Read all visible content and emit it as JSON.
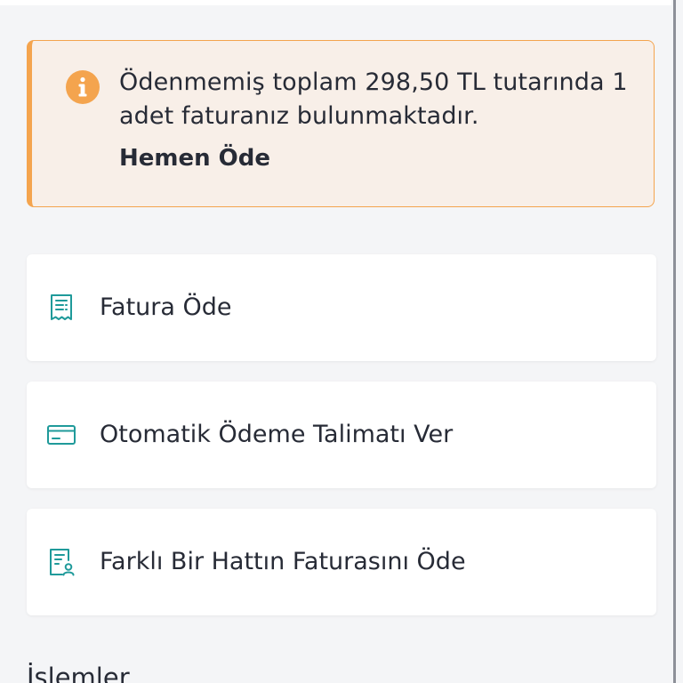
{
  "alert": {
    "message": "Ödenmemiş toplam 298,50 TL tutarında 1 adet faturanız bulunmaktadır.",
    "action_label": "Hemen Öde",
    "icon": "info-icon",
    "accent_color": "#f4a44e",
    "background_color": "#f8efe8"
  },
  "menu": {
    "items": [
      {
        "label": "Fatura Öde",
        "icon": "receipt-icon"
      },
      {
        "label": "Otomatik Ödeme Talimatı Ver",
        "icon": "credit-card-icon"
      },
      {
        "label": "Farklı Bir Hattın Faturasını Öde",
        "icon": "receipt-user-icon"
      }
    ],
    "icon_color": "#1f9a9a"
  },
  "section": {
    "title": "İşlemler"
  }
}
